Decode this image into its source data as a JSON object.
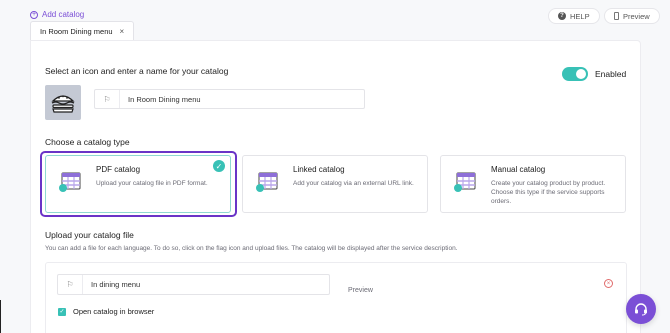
{
  "top": {
    "add_catalog": "Add catalog",
    "help": "HELP",
    "preview": "Preview",
    "tab_label": "In Room Dining menu"
  },
  "catalog": {
    "heading": "Select an icon and enter a name for your catalog",
    "name_value": "In Room Dining menu",
    "enabled_label": "Enabled",
    "enabled": true
  },
  "type_section": {
    "heading": "Choose a catalog type",
    "cards": [
      {
        "title": "PDF catalog",
        "desc": "Upload your catalog file in PDF format.",
        "selected": true
      },
      {
        "title": "Linked catalog",
        "desc": "Add your catalog via an external URL link.",
        "selected": false
      },
      {
        "title": "Manual catalog",
        "desc": "Create your catalog product by product. Choose this type if the service supports orders.",
        "selected": false
      }
    ]
  },
  "upload": {
    "heading": "Upload your catalog file",
    "description": "You can add a file for each language. To do so, click on the flag icon and upload files. The catalog will be displayed after the service description.",
    "file_name": "In dining menu",
    "preview": "Preview",
    "open_in_browser": "Open catalog in browser"
  },
  "colors": {
    "accent": "#7b4fd6",
    "teal": "#38c1b6",
    "selected_outline": "#6a34c7"
  }
}
